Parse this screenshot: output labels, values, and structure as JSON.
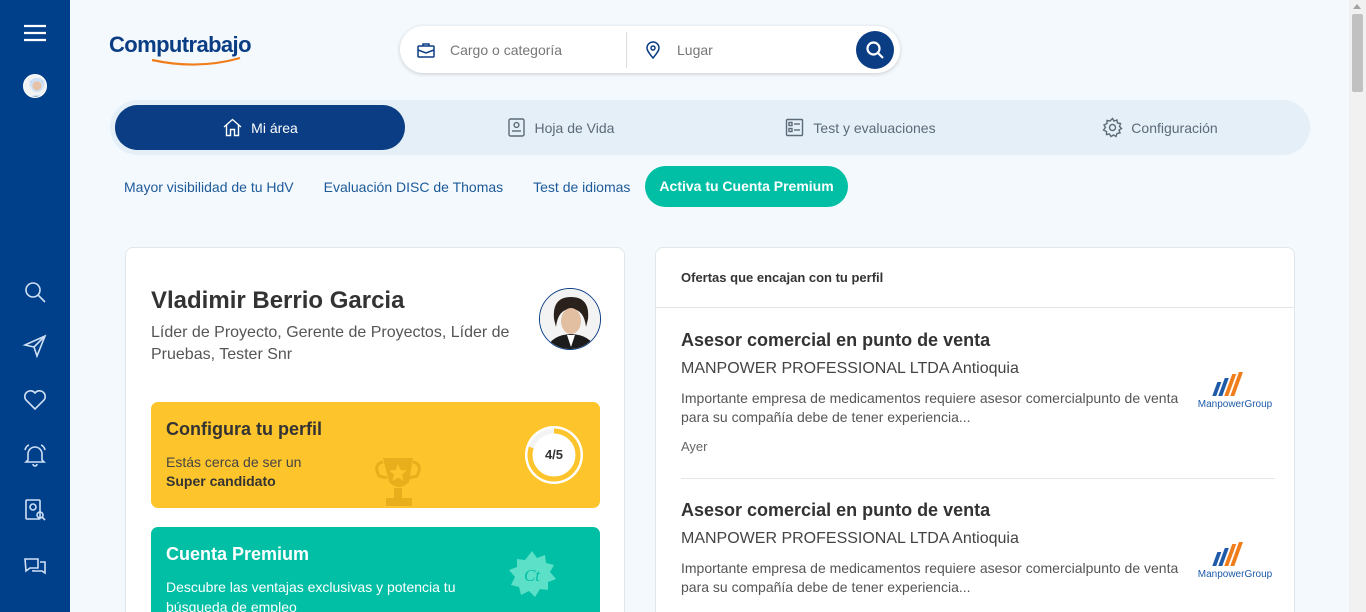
{
  "app": {
    "logo_text": "Computrabajo"
  },
  "search": {
    "job_placeholder": "Cargo o categoría",
    "location_placeholder": "Lugar"
  },
  "main_tabs": [
    {
      "label": "Mi área",
      "icon": "home-icon",
      "active": true
    },
    {
      "label": "Hoja de Vida",
      "icon": "resume-icon",
      "active": false
    },
    {
      "label": "Test y evaluaciones",
      "icon": "checklist-icon",
      "active": false
    },
    {
      "label": "Configuración",
      "icon": "gear-icon",
      "active": false
    }
  ],
  "sub_nav": {
    "items": [
      "Mayor visibilidad de tu HdV",
      "Evaluación DISC de Thomas",
      "Test de idiomas"
    ],
    "premium_label": "Activa tu Cuenta Premium"
  },
  "profile": {
    "name": "Vladimir Berrio Garcia",
    "role": "Líder de Proyecto, Gerente de Proyectos, Líder de Pruebas, Tester Snr",
    "configure": {
      "title": "Configura tu perfil",
      "text": "Estás cerca de ser un",
      "highlight": "Super candidato",
      "progress_label": "4/5",
      "progress_fraction": 0.8
    },
    "premium": {
      "title": "Cuenta Premium",
      "text": "Descubre las ventajas exclusivas y potencia tu búsqueda de empleo",
      "badge_text": "Ct"
    }
  },
  "offers": {
    "heading": "Ofertas que encajan con tu perfil",
    "items": [
      {
        "title": "Asesor comercial en punto de venta",
        "company": "MANPOWER PROFESSIONAL LTDA Antioquia",
        "description": "Importante empresa de medicamentos requiere asesor comercialpunto de venta para su compañía debe de tener experiencia...",
        "age": "Ayer",
        "logo_text": "ManpowerGroup"
      },
      {
        "title": "Asesor comercial en punto de venta",
        "company": "MANPOWER PROFESSIONAL LTDA Antioquia",
        "description": "Importante empresa de medicamentos requiere asesor comercialpunto de venta para su compañía debe de tener experiencia...",
        "age": "",
        "logo_text": "ManpowerGroup"
      }
    ]
  },
  "colors": {
    "brand_blue": "#0a3d84",
    "rail_blue": "#003f8a",
    "premium_green": "#00bfa5",
    "profile_yellow": "#fec42c",
    "manpower_orange": "#f07d1a"
  }
}
